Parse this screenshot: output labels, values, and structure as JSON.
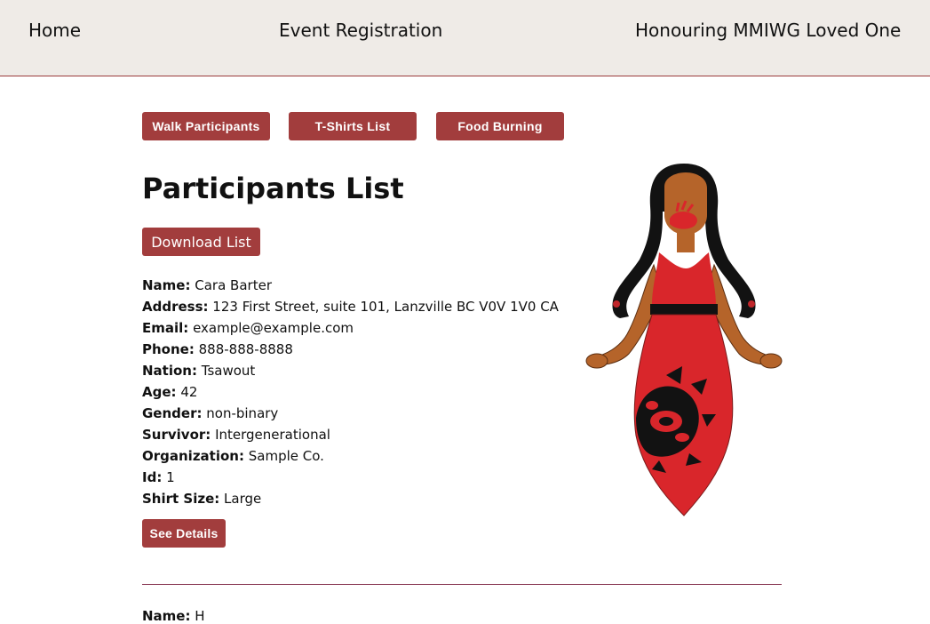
{
  "nav": {
    "home": "Home",
    "event_registration": "Event Registration",
    "honouring": "Honouring MMIWG Loved One"
  },
  "tabs": {
    "walk": "Walk Participants",
    "shirts": "T-Shirts List",
    "food": "Food Burning"
  },
  "page": {
    "title": "Participants List",
    "download": "Download List"
  },
  "participant": {
    "fields": [
      {
        "label": "Name:",
        "value": "Cara Barter"
      },
      {
        "label": "Address:",
        "value": "123 First Street, suite 101, Lanzville BC V0V 1V0 CA"
      },
      {
        "label": "Email:",
        "value": "example@example.com"
      },
      {
        "label": "Phone:",
        "value": "888-888-8888"
      },
      {
        "label": "Nation:",
        "value": "Tsawout"
      },
      {
        "label": "Age:",
        "value": "42"
      },
      {
        "label": "Gender:",
        "value": "non-binary"
      },
      {
        "label": "Survivor:",
        "value": "Intergenerational"
      },
      {
        "label": "Organization:",
        "value": "Sample Co."
      },
      {
        "label": "Id:",
        "value": "1"
      },
      {
        "label": "Shirt Size:",
        "value": "Large"
      }
    ],
    "see_details": "See Details"
  },
  "next_participant": {
    "label": "Name:",
    "value": "H"
  },
  "colors": {
    "accent": "#a23d3d",
    "nav_bg": "#efebe7",
    "dress": "#d9262b",
    "skin": "#b5642a",
    "hair": "#111111"
  },
  "image": {
    "name": "indigenous-woman-red-dress-illustration"
  }
}
